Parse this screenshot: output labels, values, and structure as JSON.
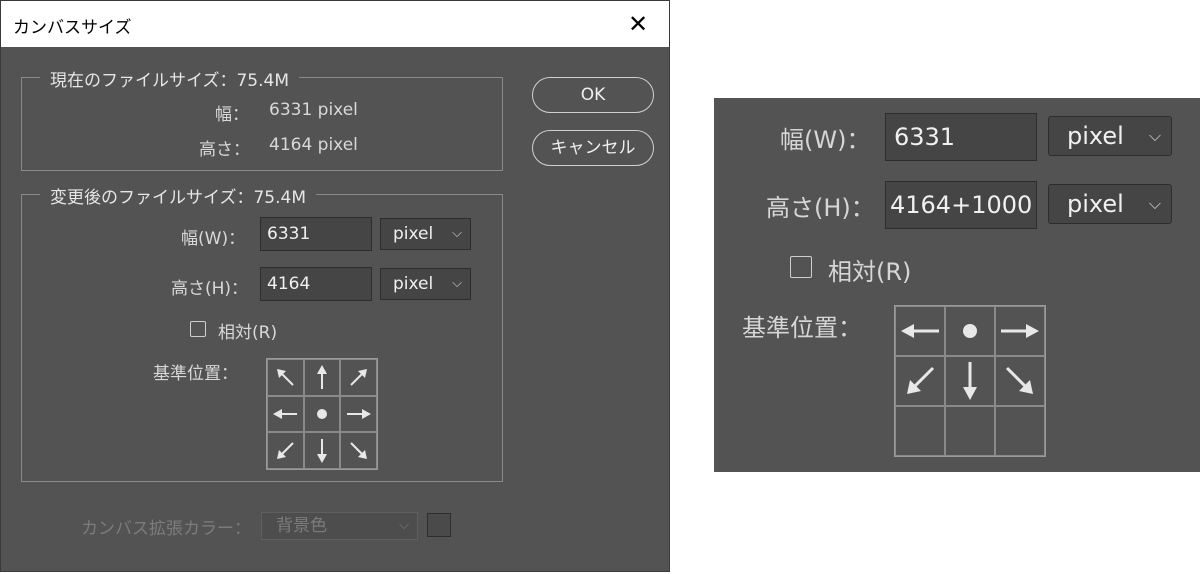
{
  "dialog": {
    "title": "カンバスサイズ",
    "current": {
      "legend": "現在のファイルサイズ：75.4M",
      "width_label": "幅：",
      "width_value": "6331 pixel",
      "height_label": "高さ：",
      "height_value": "4164 pixel"
    },
    "new": {
      "legend": "変更後のファイルサイズ：75.4M",
      "width_label": "幅(W)：",
      "width_value": "6331",
      "width_unit": "pixel",
      "height_label": "高さ(H)：",
      "height_value": "4164",
      "height_unit": "pixel",
      "relative_label": "相対(R)",
      "anchor_label": "基準位置："
    },
    "buttons": {
      "ok": "OK",
      "cancel": "キャンセル"
    },
    "extension": {
      "label": "カンバス拡張カラー：",
      "value": "背景色"
    }
  },
  "zoom": {
    "width_label": "幅(W)：",
    "width_value": "6331",
    "width_unit": "pixel",
    "height_label": "高さ(H)：",
    "height_value": "4164+1000",
    "height_unit": "pixel",
    "relative_label": "相対(R)",
    "anchor_label": "基準位置："
  },
  "colors": {
    "panel": "#535353",
    "field": "#454545",
    "title_bar": "#ffffff"
  }
}
